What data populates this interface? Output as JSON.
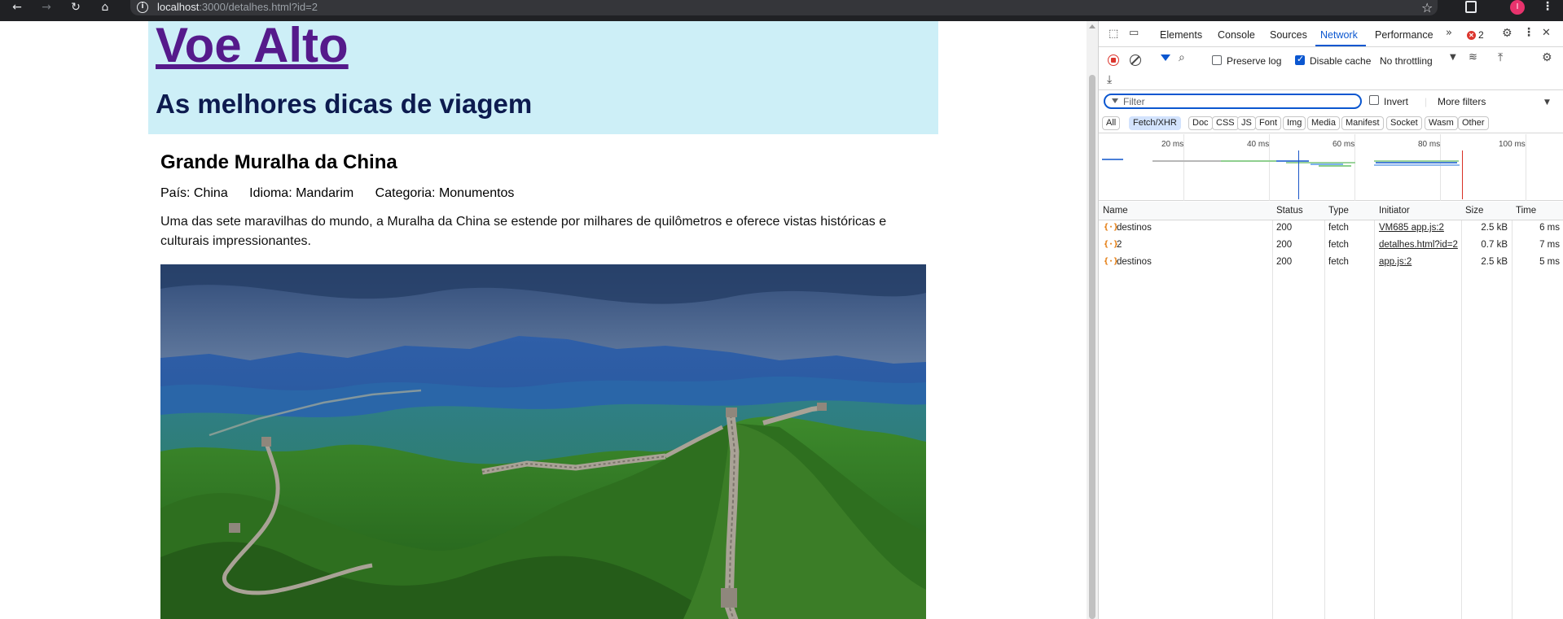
{
  "browser": {
    "url_host": "localhost",
    "url_rest": ":3000/detalhes.html?id=2",
    "profile_initial": "I"
  },
  "site": {
    "title": "Voe Alto",
    "subtitle": "As melhores dicas de viagem",
    "colors": {
      "header_bg": "#cdeff7",
      "title": "#551a8b",
      "subtitle": "#0d1b4f"
    }
  },
  "place": {
    "name": "Grande Muralha da China",
    "country": "País: China",
    "language": "Idioma: Mandarim",
    "category": "Categoria: Monumentos",
    "description": "Uma das sete maravilhas do mundo, a Muralha da China se estende por milhares de quilômetros e oferece vistas históricas e culturais impressionantes."
  },
  "devtools": {
    "tabs": [
      "Elements",
      "Console",
      "Sources",
      "Network",
      "Performance"
    ],
    "active_tab": "Network",
    "error_count": "2",
    "toolbar": {
      "preserve_log": "Preserve log",
      "disable_cache": "Disable cache",
      "throttling": "No throttling",
      "preserve_log_checked": false,
      "disable_cache_checked": true
    },
    "filter": {
      "placeholder": "Filter",
      "invert": "Invert",
      "more_filters": "More filters"
    },
    "types": [
      "All",
      "Fetch/XHR",
      "Doc",
      "CSS",
      "JS",
      "Font",
      "Img",
      "Media",
      "Manifest",
      "Socket",
      "Wasm",
      "Other"
    ],
    "active_type": "Fetch/XHR",
    "timeline_ticks": [
      "20 ms",
      "40 ms",
      "60 ms",
      "80 ms",
      "100 ms"
    ],
    "columns": [
      "Name",
      "Status",
      "Type",
      "Initiator",
      "Size",
      "Time"
    ],
    "requests": [
      {
        "name": "destinos",
        "status": "200",
        "type": "fetch",
        "initiator": "VM685 app.js:2",
        "size": "2.5 kB",
        "time": "6 ms"
      },
      {
        "name": "2",
        "status": "200",
        "type": "fetch",
        "initiator": "detalhes.html?id=2",
        "size": "0.7 kB",
        "time": "7 ms"
      },
      {
        "name": "destinos",
        "status": "200",
        "type": "fetch",
        "initiator": "app.js:2",
        "size": "2.5 kB",
        "time": "5 ms"
      }
    ]
  }
}
